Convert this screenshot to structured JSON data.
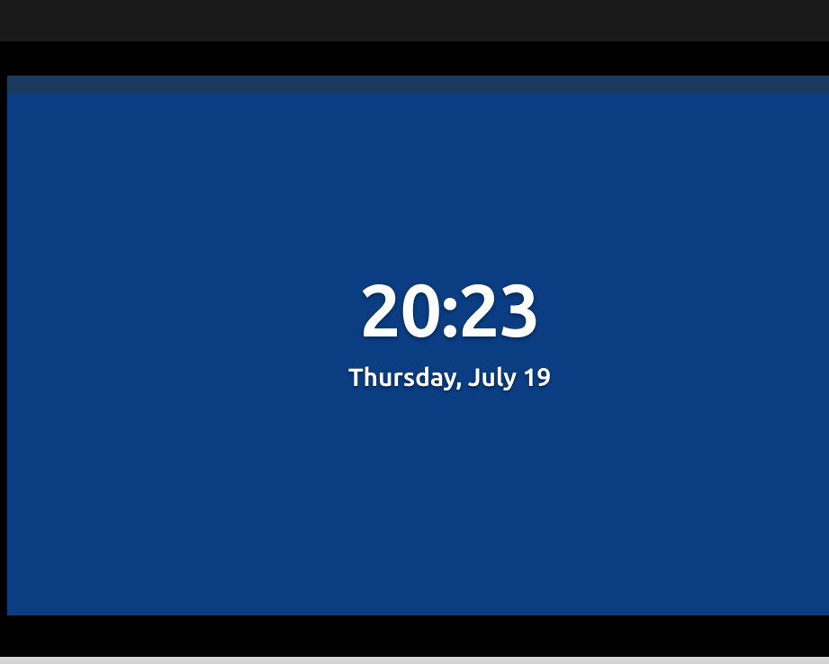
{
  "lockscreen": {
    "time": "20:23",
    "date": "Thursday, July 19",
    "colors": {
      "background": "#0a3d82",
      "topstrip": "#1a3a5e",
      "text": "#ffffff"
    }
  }
}
